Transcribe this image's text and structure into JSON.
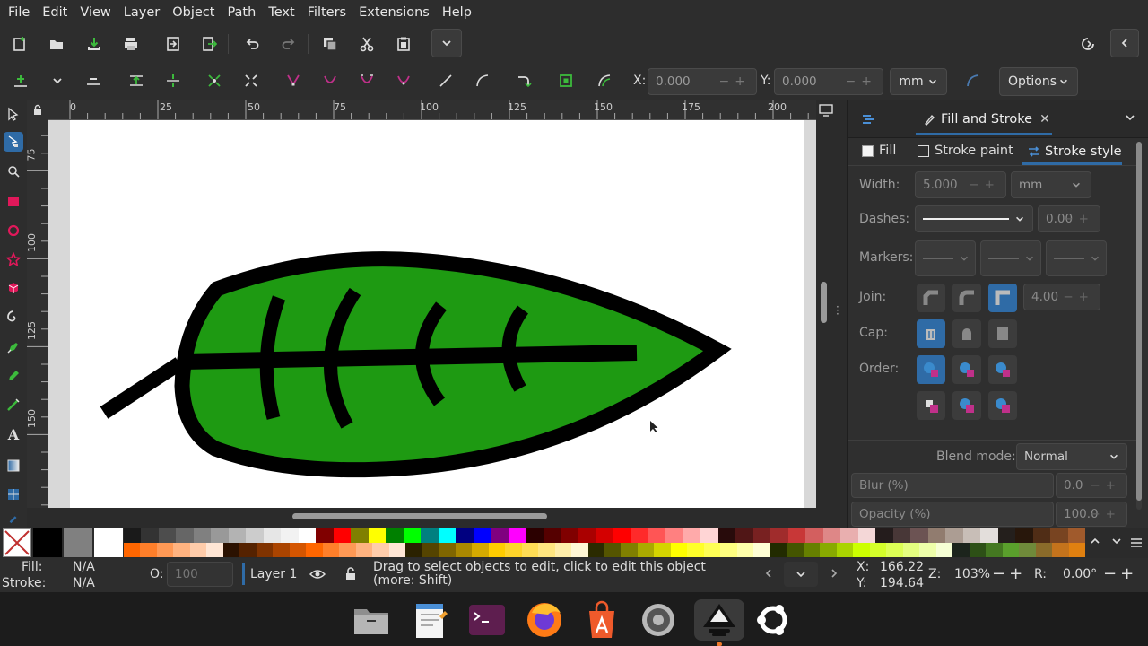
{
  "menu": [
    "File",
    "Edit",
    "View",
    "Layer",
    "Object",
    "Path",
    "Text",
    "Filters",
    "Extensions",
    "Help"
  ],
  "toolctl": {
    "x_label": "X:",
    "x_value": "0.000",
    "y_label": "Y:",
    "y_value": "0.000",
    "unit": "mm",
    "options_label": "Options"
  },
  "ruler_top": [
    "0",
    "25",
    "50",
    "75",
    "100",
    "125",
    "150",
    "175",
    "200"
  ],
  "ruler_left": [
    "75",
    "100",
    "125",
    "150"
  ],
  "panel": {
    "title": "Fill and Stroke",
    "tabs": [
      {
        "label": "Fill"
      },
      {
        "label": "Stroke paint"
      },
      {
        "label": "Stroke style"
      }
    ],
    "width_label": "Width:",
    "width_value": "5.000",
    "width_unit": "mm",
    "dashes_label": "Dashes:",
    "dashes_offset": "0.00",
    "markers_label": "Markers:",
    "join_label": "Join:",
    "miter_value": "4.00",
    "cap_label": "Cap:",
    "order_label": "Order:",
    "blend_label": "Blend mode:",
    "blend_value": "Normal",
    "blur_label": "Blur (%)",
    "blur_value": "0.0",
    "opacity_label": "Opacity (%)",
    "opacity_value": "100.0"
  },
  "status": {
    "fill_label": "Fill:",
    "fill_value": "N/A",
    "stroke_label": "Stroke:",
    "stroke_value": "N/A",
    "opacity_label": "O:",
    "opacity_value": "100",
    "layer": "Layer 1",
    "message": "Drag to select objects to edit, click to edit this object (more: Shift)",
    "x_label": "X:",
    "x_value": "166.22",
    "y_label": "Y:",
    "y_value": "194.64",
    "zoom_label": "Z:",
    "zoom_value": "103%",
    "rot_label": "R:",
    "rot_value": "0.00°"
  },
  "colors": {
    "accent": "#2f6ba6",
    "leaf_fill": "#1e9a12",
    "leaf_stroke": "#000000"
  },
  "dock": [
    "files-app",
    "text-editor-app",
    "terminal-app",
    "firefox-app",
    "app-center-app",
    "settings-app",
    "inkscape-app",
    "ubuntu-menu"
  ]
}
